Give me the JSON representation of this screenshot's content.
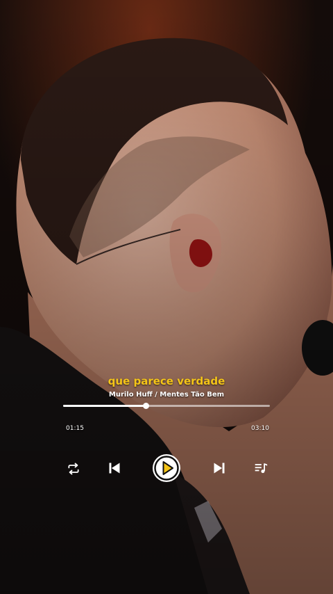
{
  "player": {
    "lyric_line": "que parece verdade",
    "track_info": "Murilo Huff / Mentes Tão Bem",
    "elapsed": "01:15",
    "total": "03:10",
    "progress_fraction": 0.4,
    "accent_color": "#f5c518"
  },
  "controls": {
    "repeat_icon": "repeat-icon",
    "previous_icon": "skip-previous-icon",
    "play_icon": "play-icon",
    "next_icon": "skip-next-icon",
    "queue_icon": "queue-music-icon"
  }
}
